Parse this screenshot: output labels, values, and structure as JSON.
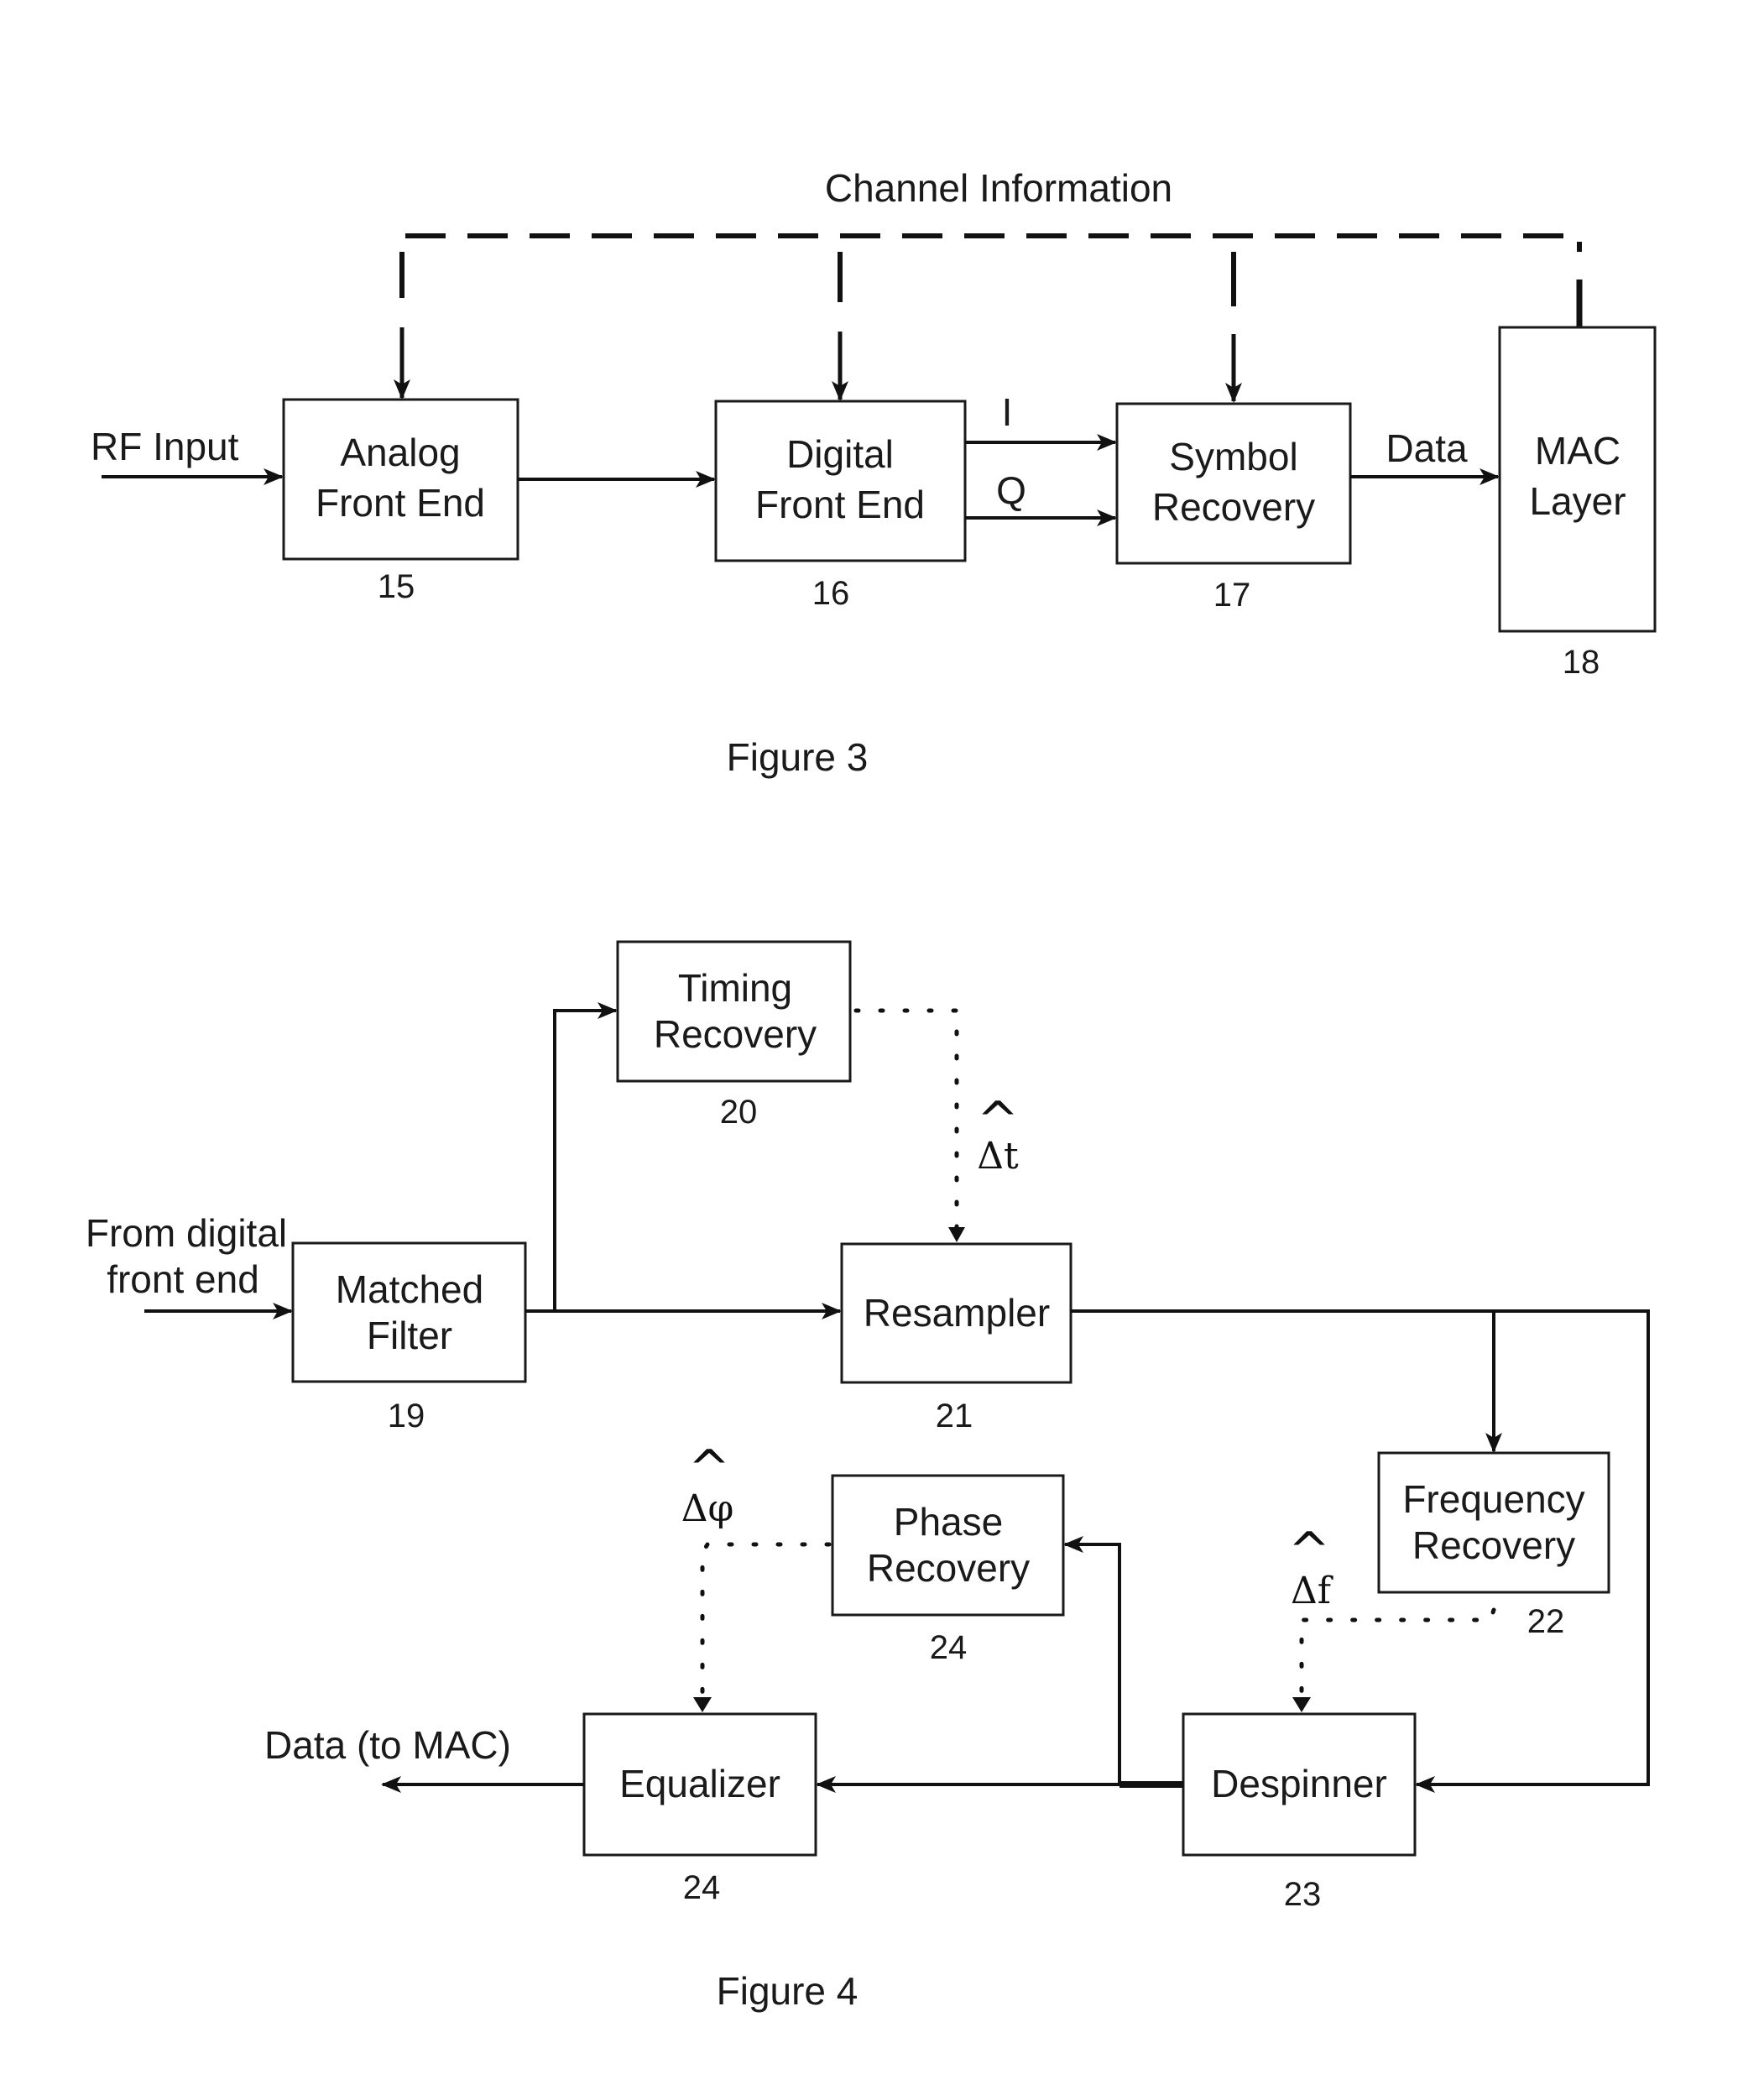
{
  "figure3": {
    "caption": "Figure 3",
    "feedback_label": "Channel Information",
    "input_label": "RF Input",
    "signal_labels": {
      "i": "I",
      "q": "Q",
      "data": "Data"
    },
    "blocks": [
      {
        "id": "analog",
        "line1": "Analog",
        "line2": "Front End",
        "ref": "15"
      },
      {
        "id": "digital",
        "line1": "Digital",
        "line2": "Front End",
        "ref": "16"
      },
      {
        "id": "symbol",
        "line1": "Symbol",
        "line2": "Recovery",
        "ref": "17"
      },
      {
        "id": "mac",
        "line1": "MAC",
        "line2": "Layer",
        "ref": "18"
      }
    ]
  },
  "figure4": {
    "caption": "Figure 4",
    "input_label_line1": "From digital",
    "input_label_line2": "front end",
    "output_label": "Data (to MAC)",
    "estimates": {
      "timing": {
        "symbol": "Δt",
        "hat": "^"
      },
      "frequency": {
        "symbol": "Δf",
        "hat": "^"
      },
      "phase": {
        "symbol": "Δφ",
        "hat": "^"
      }
    },
    "blocks": [
      {
        "id": "matched",
        "line1": "Matched",
        "line2": "Filter",
        "ref": "19"
      },
      {
        "id": "timing",
        "line1": "Timing",
        "line2": "Recovery",
        "ref": "20"
      },
      {
        "id": "resampler",
        "line1": "Resampler",
        "line2": "",
        "ref": "21"
      },
      {
        "id": "frequency",
        "line1": "Frequency",
        "line2": "Recovery",
        "ref": "22"
      },
      {
        "id": "despinner",
        "line1": "Despinner",
        "line2": "",
        "ref": "23"
      },
      {
        "id": "phase",
        "line1": "Phase",
        "line2": "Recovery",
        "ref": "24"
      },
      {
        "id": "equalizer",
        "line1": "Equalizer",
        "line2": "",
        "ref": "24"
      }
    ]
  }
}
